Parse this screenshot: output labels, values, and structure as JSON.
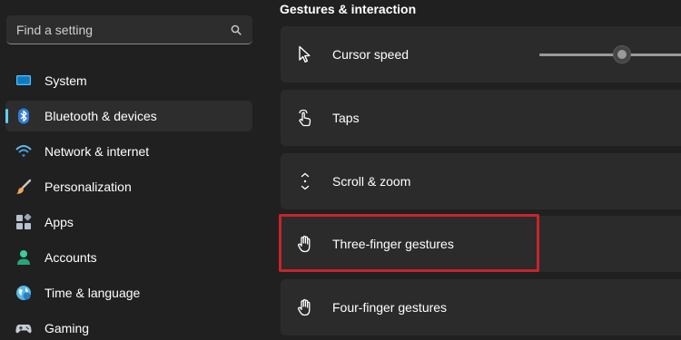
{
  "sidebar": {
    "search": {
      "placeholder": "Find a setting",
      "icon": "search-icon"
    },
    "items": [
      {
        "label": "System",
        "icon": "monitor-icon",
        "color": "#4cc2ff",
        "selected": false
      },
      {
        "label": "Bluetooth & devices",
        "icon": "bluetooth-icon",
        "color": "#2f7dd8",
        "selected": true
      },
      {
        "label": "Network & internet",
        "icon": "wifi-icon",
        "color": "#6ab7e9",
        "selected": false
      },
      {
        "label": "Personalization",
        "icon": "brush-icon",
        "color": "#f0a55a",
        "selected": false
      },
      {
        "label": "Apps",
        "icon": "apps-icon",
        "color": "#b8c1d0",
        "selected": false
      },
      {
        "label": "Accounts",
        "icon": "person-icon",
        "color": "#3ccd9a",
        "selected": false
      },
      {
        "label": "Time & language",
        "icon": "globe-icon",
        "color": "#58b7e6",
        "selected": false
      },
      {
        "label": "Gaming",
        "icon": "gamepad-icon",
        "color": "#c8ccd4",
        "selected": false
      }
    ]
  },
  "main": {
    "section_title": "Gestures & interaction",
    "cards": [
      {
        "label": "Cursor speed",
        "icon": "cursor-icon"
      },
      {
        "label": "Taps",
        "icon": "tap-icon"
      },
      {
        "label": "Scroll & zoom",
        "icon": "scroll-icon"
      },
      {
        "label": "Three-finger gestures",
        "icon": "hand-icon",
        "highlighted": true
      },
      {
        "label": "Four-finger gestures",
        "icon": "hand-icon"
      }
    ],
    "cursor_speed_slider": {
      "value_fraction": 0.55
    }
  },
  "colors": {
    "accent": "#60cdff",
    "highlight": "#c6242c",
    "background": "#202020",
    "card": "#2b2b2b"
  }
}
